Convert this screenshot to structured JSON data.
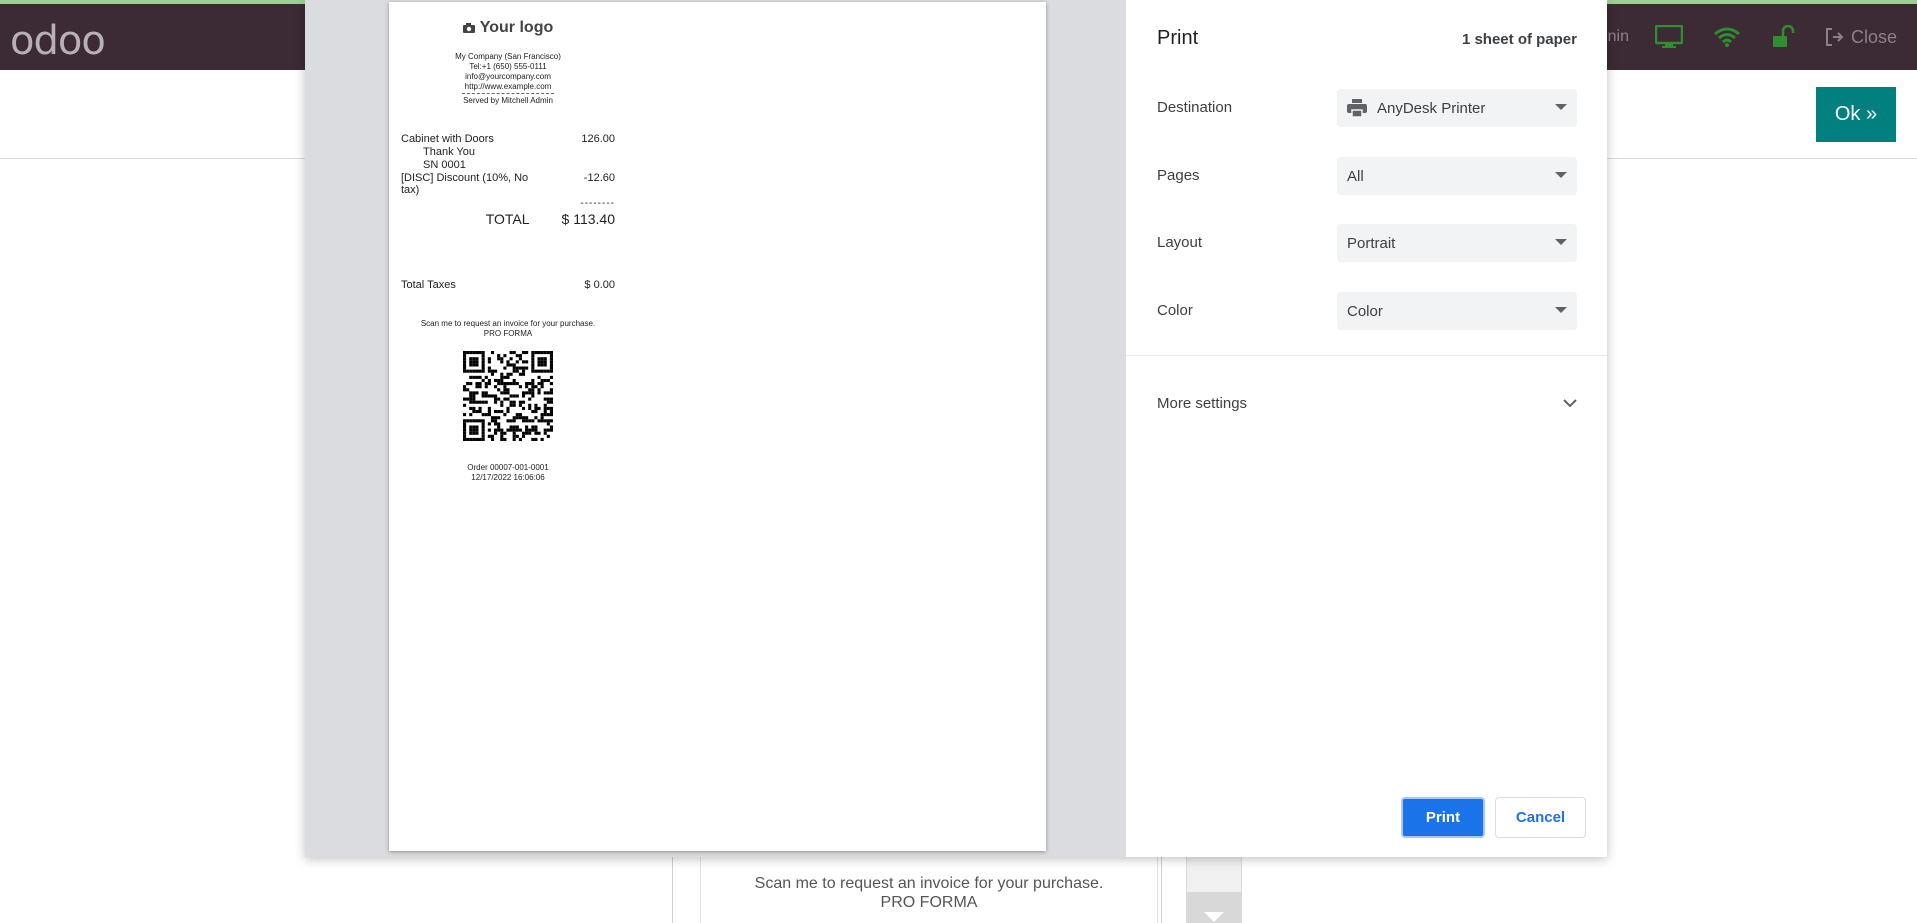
{
  "app": {
    "logo": "odoo",
    "user_fragment": "nin",
    "close_label": "Close",
    "ok_label": "Ok »",
    "icons": [
      "monitor-icon",
      "wifi-icon",
      "unlock-icon",
      "sign-out-icon"
    ],
    "accent_color": "#01807f",
    "topbar_color": "#3c2a35"
  },
  "background_receipt": {
    "line1": "Scan me to request an invoice for your purchase.",
    "line2": "PRO FORMA"
  },
  "receipt": {
    "logo_text": "Your logo",
    "company": [
      "My Company (San Francisco)",
      "Tel:+1 (650) 555-0111",
      "info@yourcompany.com",
      "http://www.example.com"
    ],
    "served_by": "Served by Mitchell Admin",
    "lines": [
      {
        "name": "Cabinet with Doors",
        "amount": "126.00"
      },
      {
        "note": "Thank You"
      },
      {
        "note": "SN 0001"
      },
      {
        "name": "[DISC] Discount (10%, No tax)",
        "amount": "-12.60"
      }
    ],
    "separator": "--------",
    "total_label": "TOTAL",
    "total_value": "$ 113.40",
    "taxes_label": "Total Taxes",
    "taxes_value": "$ 0.00",
    "scan_line1": "Scan me to request an invoice for your purchase.",
    "scan_line2": "PRO FORMA",
    "order_number": "Order 00007-001-0001",
    "order_date": "12/17/2022 16:06:06"
  },
  "print": {
    "title": "Print",
    "sheets": "1 sheet of paper",
    "destination_label": "Destination",
    "destination_value": "AnyDesk Printer",
    "pages_label": "Pages",
    "pages_value": "All",
    "layout_label": "Layout",
    "layout_value": "Portrait",
    "color_label": "Color",
    "color_value": "Color",
    "more_settings": "More settings",
    "print_button": "Print",
    "cancel_button": "Cancel",
    "primary_color": "#1a73e8"
  }
}
